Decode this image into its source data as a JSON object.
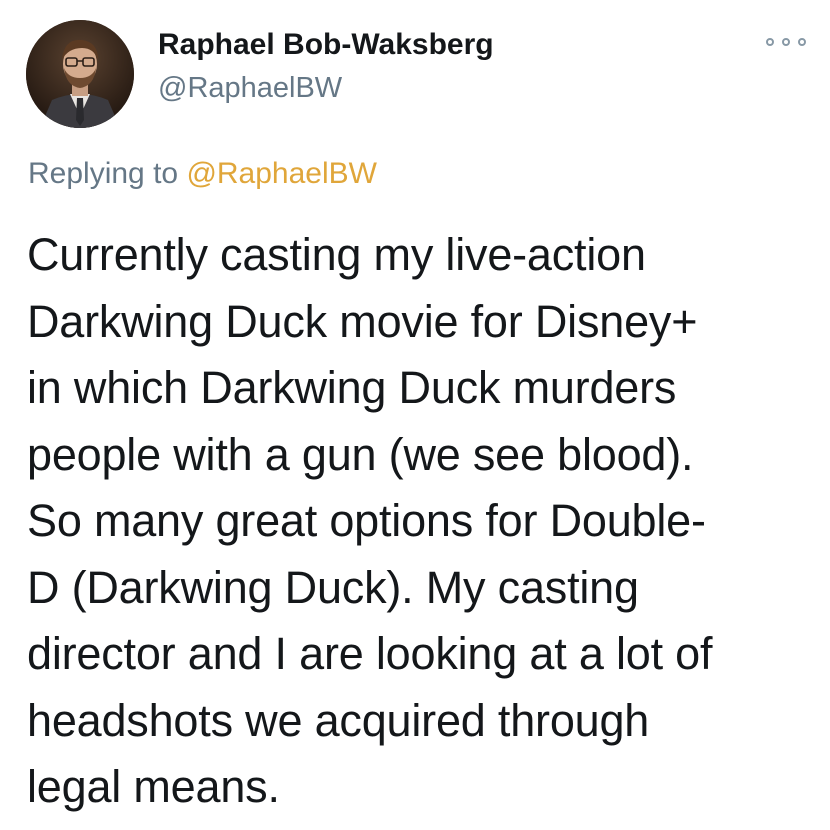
{
  "author": {
    "display_name": "Raphael Bob-Waksberg",
    "handle": "@RaphaelBW",
    "avatar_icon": "profile-photo"
  },
  "menu": {
    "icon": "more-options-icon"
  },
  "reply": {
    "prefix": "Replying to ",
    "mention": "@RaphaelBW",
    "mention_color": "#e0a63a"
  },
  "tweet": {
    "lines": [
      "Currently casting my live-action",
      "Darkwing Duck movie for Disney+",
      "in which Darkwing Duck murders",
      "people with a gun (we see blood).",
      "So many great options for Double-",
      "D (Darkwing Duck). My casting",
      "director and I are looking at a lot of",
      "headshots we acquired through",
      "legal means."
    ]
  },
  "colors": {
    "text": "#14171a",
    "secondary": "#657786"
  }
}
